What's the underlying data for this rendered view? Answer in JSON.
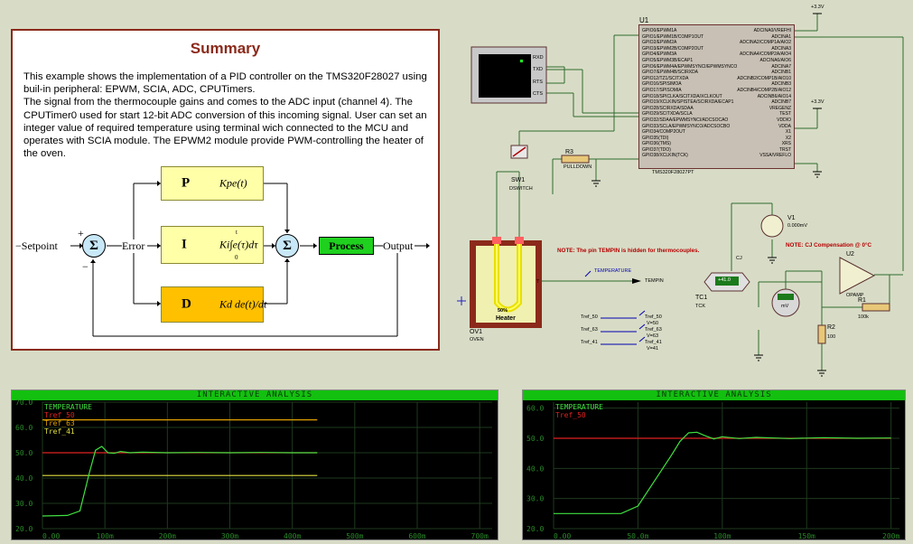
{
  "summary": {
    "title": "Summary",
    "p1": "This example shows the implementation of a PID controller on the TMS320F28027 using buil-in peripheral: EPWM, SCIA, ADC, CPUTimers.",
    "p2": "The signal from the thermocouple gains and comes to the ADC input (channel 4). The CPUTimer0 used for start 12-bit ADC conversion of this incoming signal. User can set an integer value of required temperature using terminal wich connected to the MCU and operates with SCIA module. The EPWM2 module provide PWM-controlling the heater of the oven."
  },
  "pid": {
    "setpoint": "Setpoint",
    "error": "Error",
    "output": "Output",
    "process": "Process",
    "p": "P",
    "i": "I",
    "d": "D",
    "sum": "Σ",
    "plus": "+",
    "minus": "−",
    "p_formula": "Kpe(t)",
    "i_formula": "Ki∫e(τ)dτ",
    "d_formula": "Kd de(t)/dt",
    "i_upper": "t",
    "i_lower": "0"
  },
  "schematic": {
    "terminal_pins": [
      "RXD",
      "TXD",
      "RTS",
      "CTS"
    ],
    "mcu_ref": "U1",
    "mcu_part": "TMS320F28027PT",
    "mcu_pins_left": [
      "GPIO0/EPWM1A",
      "GPIO1/EPWM1B/COMP1OUT",
      "GPIO2/EPWM2A",
      "GPIO3/EPWM2B/COMP2OUT",
      "GPIO4/EPWM3A",
      "GPIO5/EPWM3B/ECAP1",
      "GPIO6/EPWM4A/EPWMSYNCI/EPWMSYNCO",
      "GPIO7/EPWM4B/SCIRXDA",
      "GPIO12/TZ1/SCITXDA",
      "GPIO16/SPISIMOA",
      "GPIO17/SPISOMIA",
      "GPIO18/SPICLKA/SCITXDA/XCLKOUT",
      "GPIO19/XCLKIN/SPISTEA/SCIRXDA/ECAP1",
      "GPIO28/SCIRXDA/SDAA",
      "GPIO29/SCITXDA/SCLA",
      "GPIO32/SDAA/EPWMSYNCI/ADCSOCAO",
      "GPIO33/SCLA/EPWMSYNCO/ADCSOCBO",
      "GPIO34/COMP2OUT",
      "GPIO35(TDI)",
      "GPIO36(TMS)",
      "GPIO37(TDO)",
      "GPIO38/XCLKIN(TCK)"
    ],
    "mcu_pins_right": [
      "ADCINA0/VREFHI",
      "ADCINA1",
      "ADCINA2/COMP1A/AIO2",
      "ADCINA3",
      "ADCINA4/COMP2A/AIO4",
      "ADCINA6/AIO6",
      "ADCINA7",
      "ADCINB1",
      "ADCINB2/COMP1B/AIO10",
      "ADCINB3",
      "ADCINB4/COMP2B/AIO12",
      "ADCINB6/AIO14",
      "ADCINB7",
      "VREGENZ",
      "TEST",
      "VDDIO",
      "VDDA",
      "X1",
      "X2",
      "XRS",
      "TRST",
      "VSSA/VREFLO"
    ],
    "vcc1": "+3.3V",
    "vcc2": "+3.3V",
    "r3_ref": "R3",
    "r3_label": "PULLDOWN",
    "sw_ref": "SW1",
    "sw_label": "DSWITCH",
    "oven_ref": "OV1",
    "oven_label": "OVEN",
    "heater_pct": "50%",
    "heater_label": "Heater",
    "oven_t": "T",
    "note1": "NOTE: The pin TEMPIN is hidden for thermocouples.",
    "note2": "NOTE: CJ Compensation @ 0°C",
    "temperature_label": "TEMPERATURE",
    "tempin_label": "TEMPIN",
    "v1_ref": "V1",
    "v1_value": "0.000mV",
    "cj_label": "CJ",
    "tc_ref": "TC1",
    "tc_type": "TCK",
    "tc_display": "+41.0",
    "meter_unit": "mV",
    "u2_ref": "U2",
    "u2_label": "OPAMP",
    "r1_ref": "R1",
    "r1_value": "100k",
    "r2_ref": "R2",
    "r2_value": "100",
    "trefs": [
      {
        "name": "Tref_50",
        "v": "V=50"
      },
      {
        "name": "Tref_63",
        "v": "V=63"
      },
      {
        "name": "Tref_41",
        "v": "V=41"
      }
    ]
  },
  "graph1": {
    "header": "INTERACTIVE ANALYSIS",
    "legend": [
      {
        "label": "TEMPERATURE",
        "color": "#40e040"
      },
      {
        "label": "Tref_50",
        "color": "#e02020"
      },
      {
        "label": "Tref_63",
        "color": "#e0a000"
      },
      {
        "label": "Tref_41",
        "color": "#e0e040"
      }
    ]
  },
  "graph2": {
    "header": "INTERACTIVE ANALYSIS",
    "legend": [
      {
        "label": "TEMPERATURE",
        "color": "#40e040"
      },
      {
        "label": "Tref_50",
        "color": "#e02020"
      }
    ]
  },
  "chart_data": [
    {
      "type": "line",
      "x_ticks": [
        "0.00",
        "100m",
        "200m",
        "300m",
        "400m",
        "500m",
        "600m",
        "700m"
      ],
      "x_values": [
        0,
        0.1,
        0.2,
        0.3,
        0.4,
        0.5,
        0.6,
        0.7
      ],
      "y_ticks": [
        "20.0",
        "30.0",
        "40.0",
        "50.0",
        "60.0",
        "70.0"
      ],
      "ylim": [
        20,
        70
      ],
      "xlim": [
        0,
        0.72
      ],
      "grid": true,
      "series": [
        {
          "name": "TEMPERATURE",
          "color": "#40e040",
          "x": [
            0,
            0.04,
            0.06,
            0.075,
            0.085,
            0.095,
            0.105,
            0.115,
            0.125,
            0.14,
            0.16,
            0.2,
            0.25,
            0.3,
            0.35,
            0.4,
            0.44
          ],
          "y": [
            25,
            25.2,
            27,
            42,
            51,
            52.5,
            50,
            49.8,
            50.5,
            50,
            50.2,
            50,
            50.1,
            50,
            50.1,
            50,
            50
          ]
        },
        {
          "name": "Tref_50",
          "color": "#e02020",
          "x": [
            0,
            0.44
          ],
          "y": [
            50,
            50
          ]
        },
        {
          "name": "Tref_63",
          "color": "#e0a000",
          "x": [
            0,
            0.44
          ],
          "y": [
            63,
            63
          ]
        },
        {
          "name": "Tref_41",
          "color": "#e0e040",
          "x": [
            0,
            0.44
          ],
          "y": [
            41,
            41
          ]
        }
      ]
    },
    {
      "type": "line",
      "x_ticks": [
        "0.00",
        "50.0m",
        "100m",
        "150m",
        "200m"
      ],
      "x_values": [
        0,
        0.05,
        0.1,
        0.15,
        0.2
      ],
      "y_ticks": [
        "20.0",
        "30.0",
        "40.0",
        "50.0",
        "60.0"
      ],
      "ylim": [
        20,
        62
      ],
      "xlim": [
        0,
        0.205
      ],
      "grid": true,
      "series": [
        {
          "name": "TEMPERATURE",
          "color": "#40e040",
          "x": [
            0,
            0.04,
            0.05,
            0.06,
            0.07,
            0.075,
            0.08,
            0.085,
            0.09,
            0.095,
            0.1,
            0.11,
            0.12,
            0.14,
            0.16,
            0.18,
            0.2
          ],
          "y": [
            25,
            25,
            27.5,
            36,
            44.5,
            49,
            51.8,
            52,
            50.8,
            49.8,
            50.5,
            49.9,
            50.3,
            49.9,
            50.2,
            50,
            50.1
          ]
        },
        {
          "name": "Tref_50",
          "color": "#e02020",
          "x": [
            0,
            0.2
          ],
          "y": [
            50,
            50
          ]
        }
      ]
    }
  ]
}
